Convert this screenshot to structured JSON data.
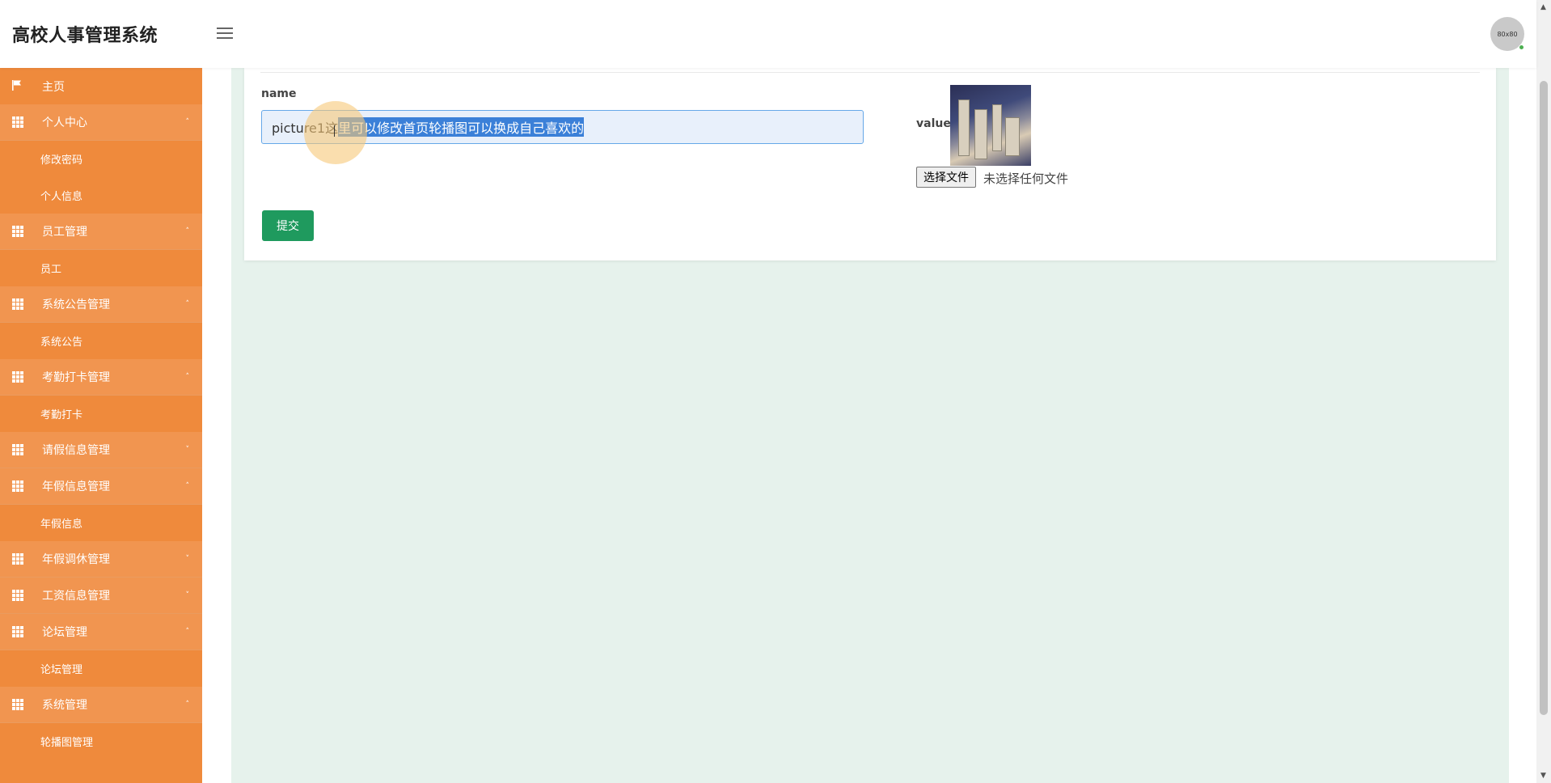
{
  "header": {
    "title": "高校人事管理系统",
    "avatar_text": "80x80"
  },
  "sidebar": {
    "items": [
      {
        "type": "home",
        "label": "主页",
        "icon": "flag-icon"
      },
      {
        "type": "group",
        "label": "个人中心",
        "icon": "grid-icon",
        "caret": "˄"
      },
      {
        "type": "sub",
        "label": "修改密码"
      },
      {
        "type": "sub",
        "label": "个人信息"
      },
      {
        "type": "group",
        "label": "员工管理",
        "icon": "grid-icon",
        "caret": "˄"
      },
      {
        "type": "sub",
        "label": "员工"
      },
      {
        "type": "group",
        "label": "系统公告管理",
        "icon": "grid-icon",
        "caret": "˄"
      },
      {
        "type": "sub",
        "label": "系统公告"
      },
      {
        "type": "group",
        "label": "考勤打卡管理",
        "icon": "grid-icon",
        "caret": "˄"
      },
      {
        "type": "sub",
        "label": "考勤打卡"
      },
      {
        "type": "group",
        "label": "请假信息管理",
        "icon": "grid-icon",
        "caret": "˅"
      },
      {
        "type": "group",
        "label": "年假信息管理",
        "icon": "grid-icon",
        "caret": "˄"
      },
      {
        "type": "sub",
        "label": "年假信息"
      },
      {
        "type": "group",
        "label": "年假调休管理",
        "icon": "grid-icon",
        "caret": "˅"
      },
      {
        "type": "group",
        "label": "工资信息管理",
        "icon": "grid-icon",
        "caret": "˅"
      },
      {
        "type": "group",
        "label": "论坛管理",
        "icon": "grid-icon",
        "caret": "˄"
      },
      {
        "type": "sub",
        "label": "论坛管理"
      },
      {
        "type": "group",
        "label": "系统管理",
        "icon": "grid-icon",
        "caret": "˄"
      },
      {
        "type": "sub",
        "label": "轮播图管理"
      }
    ]
  },
  "form": {
    "name_label": "name",
    "name_value_prefix": "picture1这",
    "name_value_selected": "里可以修改首页轮播图可以换成自己喜欢的",
    "value_label": "value",
    "file_button": "选择文件",
    "file_status": "未选择任何文件",
    "submit": "提交"
  },
  "colors": {
    "sidebar": "#ef8a3c",
    "main_bg": "#e6f2ec",
    "submit": "#1f9a5e"
  }
}
